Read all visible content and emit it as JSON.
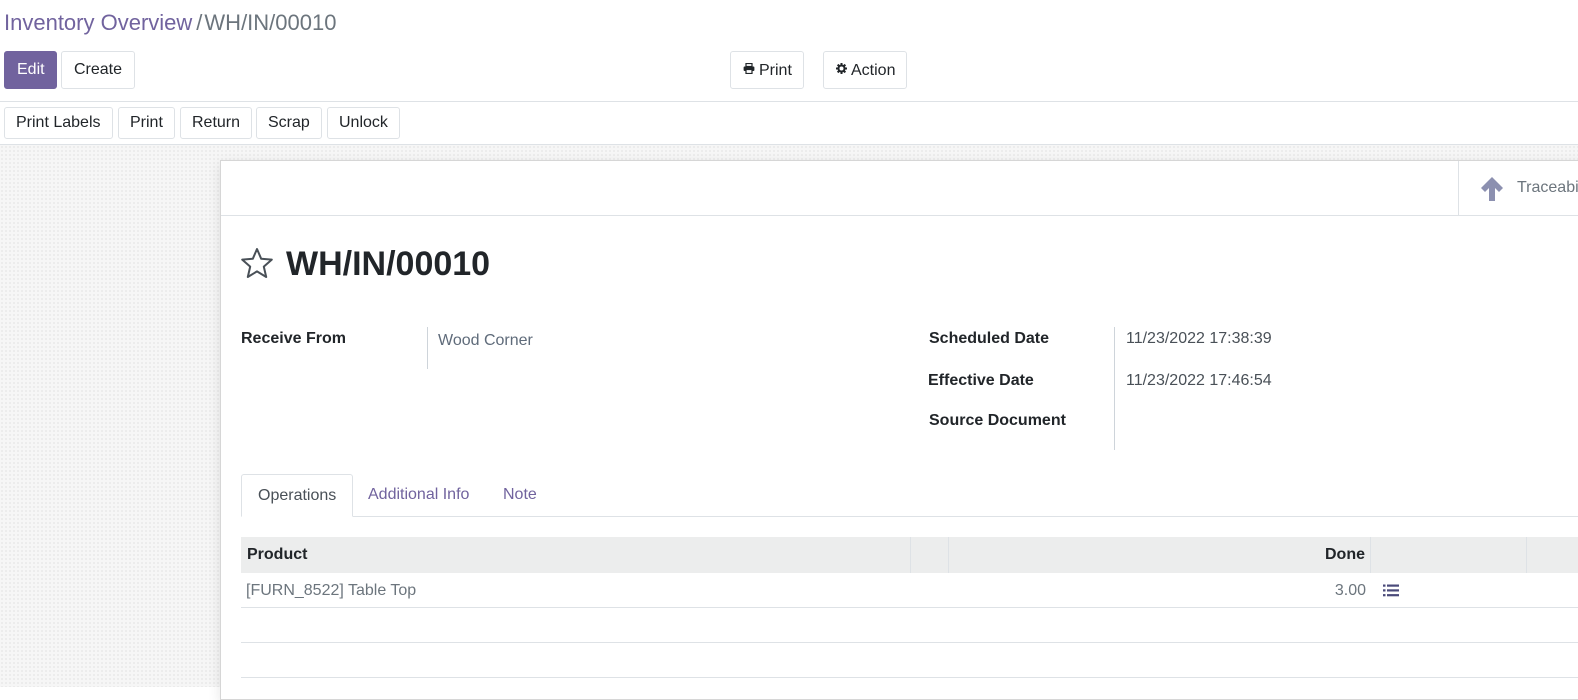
{
  "breadcrumb": {
    "parent": "Inventory Overview",
    "separator": "/",
    "current": "WH/IN/00010"
  },
  "toolbar": {
    "edit_label": "Edit",
    "create_label": "Create",
    "print_label": "Print",
    "action_label": "Action"
  },
  "statusbar": {
    "buttons": [
      "Print Labels",
      "Print",
      "Return",
      "Scrap",
      "Unlock"
    ]
  },
  "smart_button": {
    "label": "Traceability",
    "icon": "arrow-up-icon"
  },
  "form": {
    "title": "WH/IN/00010",
    "receive_from_label": "Receive From",
    "receive_from_value": "Wood Corner",
    "scheduled_date_label": "Scheduled Date",
    "scheduled_date_value": "11/23/2022 17:38:39",
    "effective_date_label": "Effective Date",
    "effective_date_value": "11/23/2022 17:46:54",
    "source_document_label": "Source Document",
    "source_document_value": ""
  },
  "tabs": [
    {
      "label": "Operations",
      "active": true
    },
    {
      "label": "Additional Info",
      "active": false
    },
    {
      "label": "Note",
      "active": false
    }
  ],
  "operations_table": {
    "headers": [
      "Product",
      "",
      "Done",
      ""
    ],
    "rows": [
      {
        "product": "[FURN_8522] Table Top",
        "done": "3.00",
        "icon": "list-icon"
      }
    ]
  },
  "colors": {
    "accent": "#71639e",
    "link": "#71639e",
    "background": "#f6f6f6"
  }
}
